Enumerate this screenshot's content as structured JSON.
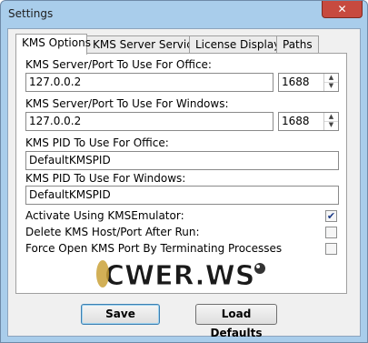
{
  "window": {
    "title": "Settings",
    "close_glyph": "✕"
  },
  "tabs": [
    {
      "label": "KMS Options",
      "active": true
    },
    {
      "label": "KMS Server Service",
      "active": false
    },
    {
      "label": "License Display",
      "active": false
    },
    {
      "label": "Paths",
      "active": false
    }
  ],
  "office_server": {
    "label": "KMS Server/Port To Use For Office:",
    "host": "127.0.0.2",
    "port": "1688"
  },
  "windows_server": {
    "label": "KMS Server/Port To Use For Windows:",
    "host": "127.0.0.2",
    "port": "1688"
  },
  "office_pid": {
    "label": "KMS PID To Use For Office:",
    "value": "DefaultKMSPID"
  },
  "windows_pid": {
    "label": "KMS PID To Use For Windows:",
    "value": "DefaultKMSPID"
  },
  "options": [
    {
      "label": "Activate Using KMSEmulator:",
      "checked": true
    },
    {
      "label": "Delete KMS Host/Port After Run:",
      "checked": false
    },
    {
      "label": "Force Open KMS Port By Terminating Processes",
      "checked": false
    }
  ],
  "check_mark": "✔",
  "watermark": "CWER.WS",
  "buttons": {
    "save": "Save",
    "load_defaults": "Load Defaults"
  },
  "colors": {
    "frame": "#a9cdeb",
    "close": "#c74a3f",
    "check": "#1b3a86"
  }
}
